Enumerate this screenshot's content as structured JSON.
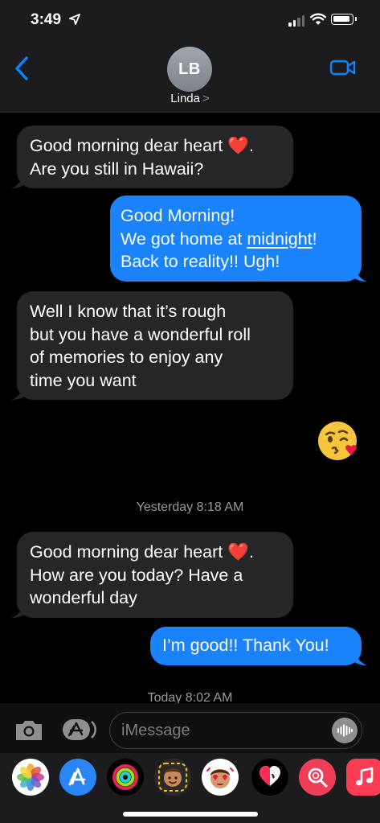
{
  "status_bar": {
    "time": "3:49"
  },
  "header": {
    "back_label": "back",
    "avatar_initials": "LB",
    "contact_name": "Linda",
    "name_chevron": ">"
  },
  "messages": [
    {
      "direction": "incoming",
      "lines": [
        "Good morning dear heart ❤️.",
        "Are you still in Hawaii?"
      ]
    },
    {
      "direction": "outgoing",
      "lines": [
        "Good Morning!",
        "We got home at ",
        "midnight",
        "!",
        "Back to reality!! Ugh!"
      ]
    },
    {
      "direction": "incoming",
      "lines": [
        "Well I know that it’s rough",
        "but you have a wonderful roll",
        "of memories to enjoy any",
        "time you want"
      ]
    },
    {
      "direction": "outgoing",
      "emoji": "😘"
    },
    {
      "direction": "incoming",
      "lines": [
        "Good morning dear heart ❤️.",
        "How are you today?  Have a",
        "wonderful day"
      ]
    },
    {
      "direction": "outgoing",
      "lines": [
        "I’m good!! Thank You!"
      ]
    }
  ],
  "timestamps": [
    {
      "day": "Yesterday",
      "time": "8:18 AM"
    },
    {
      "day": "Today",
      "time": "8:02 AM"
    }
  ],
  "input": {
    "placeholder": "iMessage"
  },
  "app_tray": {
    "icons": [
      "photos-icon",
      "app-store-icon",
      "activity-icon",
      "memoji-icon",
      "memoji-stickers-icon",
      "digital-touch-icon",
      "images-search-icon",
      "music-icon"
    ]
  },
  "colors": {
    "incoming_bubble": "#262629",
    "outgoing_bubble": "#1a82fb",
    "accent": "#0a84ff"
  }
}
